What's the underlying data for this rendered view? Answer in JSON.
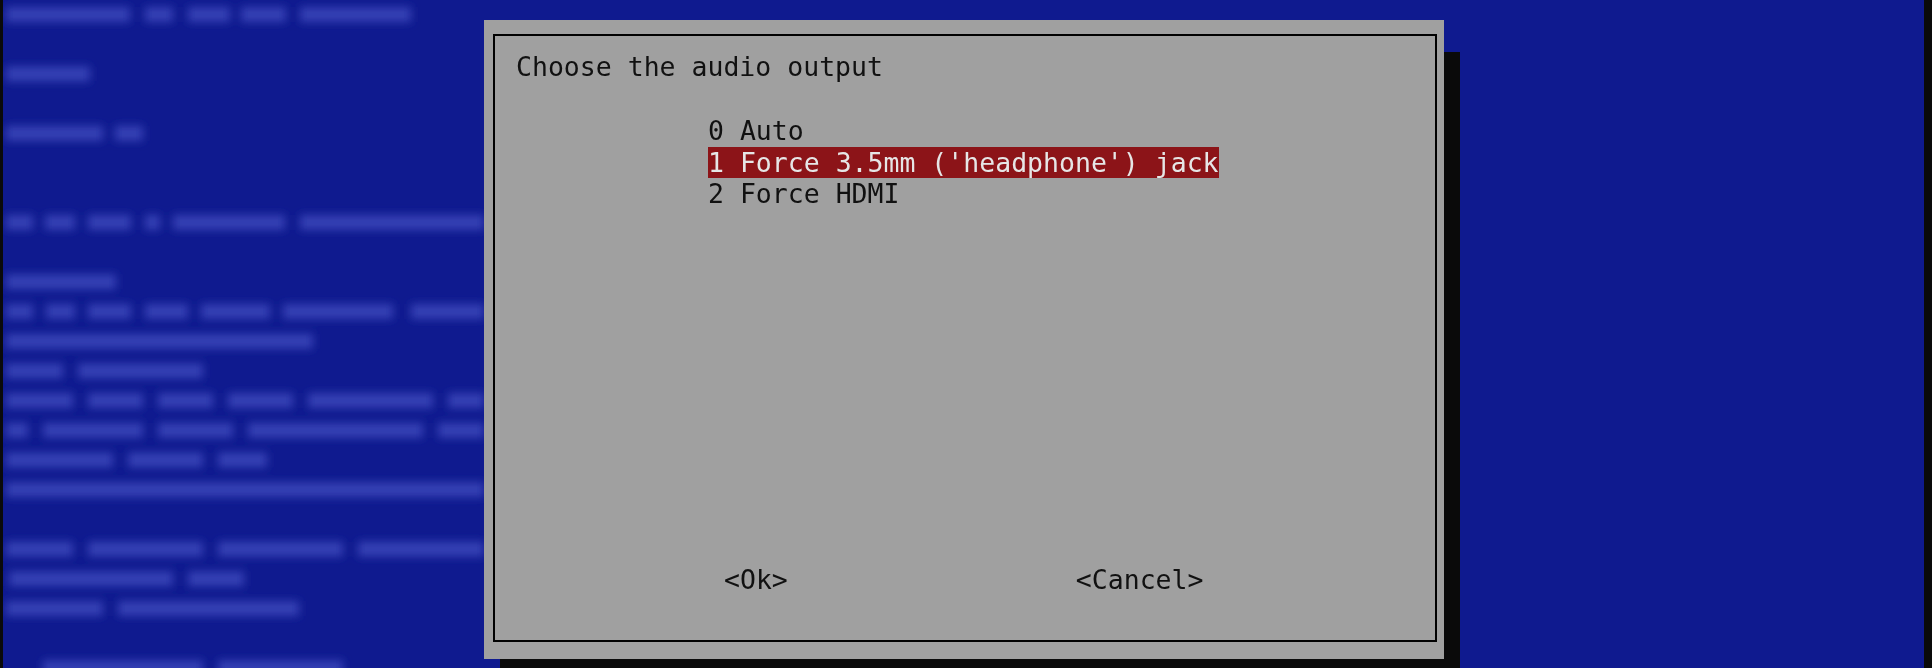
{
  "dialog": {
    "title": "Choose the audio output",
    "items": [
      {
        "tag": "0",
        "label": "Auto",
        "selected": false
      },
      {
        "tag": "1",
        "label": "Force 3.5mm ('headphone') jack",
        "selected": true
      },
      {
        "tag": "2",
        "label": "Force HDMI",
        "selected": false
      }
    ],
    "buttons": [
      {
        "label": "<Ok>"
      },
      {
        "label": "<Cancel>"
      }
    ]
  }
}
